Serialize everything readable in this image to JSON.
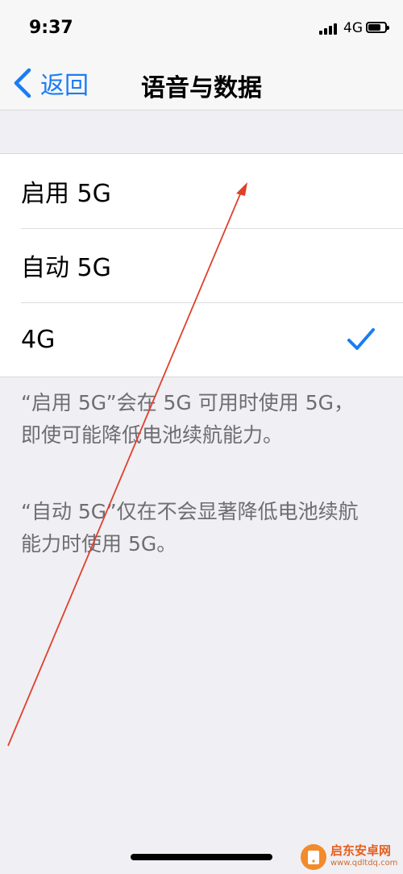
{
  "status_bar": {
    "time": "9:37",
    "network": "4G"
  },
  "nav": {
    "back_label": "返回",
    "title": "语音与数据"
  },
  "options": [
    {
      "label": "启用 5G",
      "selected": false
    },
    {
      "label": "自动 5G",
      "selected": false
    },
    {
      "label": "4G",
      "selected": true
    }
  ],
  "footnotes": [
    "“启用 5G”会在 5G 可用时使用 5G，即使可能降低电池续航能力。",
    "“自动 5G”仅在不会显著降低电池续航能力时使用 5G。"
  ],
  "watermark": {
    "name": "启东安卓网",
    "url": "www.qdltdq.com"
  },
  "colors": {
    "accent": "#1a7cf5",
    "annotation": "#e0402a",
    "background": "#efeff4"
  },
  "icons": {
    "back": "chevron-left-icon",
    "selected": "checkmark-icon"
  }
}
